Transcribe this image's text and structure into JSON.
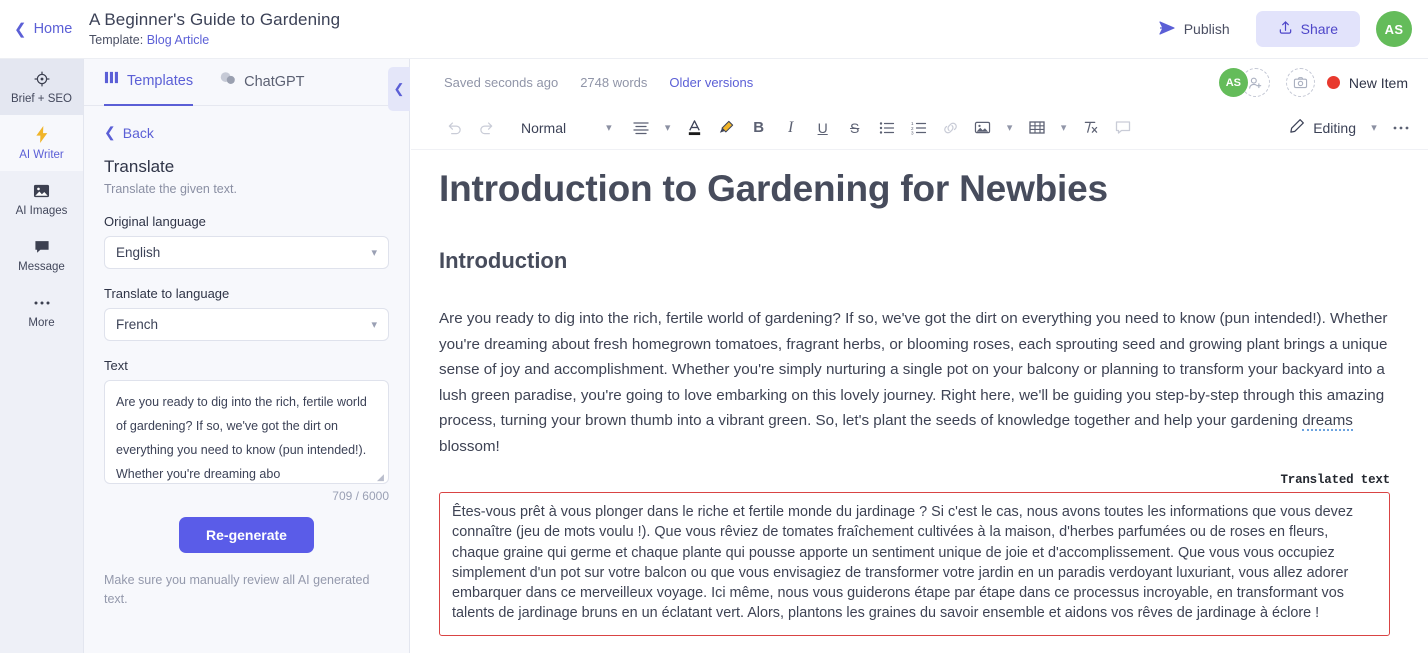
{
  "topbar": {
    "home_label": "Home",
    "back_icon": "chevron-left-icon",
    "doc_title": "A Beginner's Guide to Gardening",
    "template_prefix": "Template:",
    "template_name": "Blog Article",
    "publish_label": "Publish",
    "publish_icon": "send-icon",
    "share_label": "Share",
    "share_icon": "upload-icon",
    "avatar_initials": "AS"
  },
  "rail": {
    "items": [
      {
        "label": "Brief + SEO",
        "icon": "target-icon",
        "state": "hover"
      },
      {
        "label": "AI Writer",
        "icon": "lightning-icon",
        "state": "active"
      },
      {
        "label": "AI Images",
        "icon": "image-icon",
        "state": "default"
      },
      {
        "label": "Message",
        "icon": "message-icon",
        "state": "default"
      },
      {
        "label": "More",
        "icon": "ellipsis-icon",
        "state": "default"
      }
    ]
  },
  "panel": {
    "tabs": [
      {
        "label": "Templates",
        "icon": "templates-icon",
        "active": true
      },
      {
        "label": "ChatGPT",
        "icon": "chat-icon",
        "active": false
      }
    ],
    "collapse_icon": "chevron-left-icon",
    "back_label": "Back",
    "title": "Translate",
    "description": "Translate the given text.",
    "original_language_label": "Original language",
    "original_language_value": "English",
    "target_language_label": "Translate to language",
    "target_language_value": "French",
    "text_label": "Text",
    "text_value": "Are you ready to dig into the rich, fertile world of gardening? If so, we've got the dirt on everything you need to know (pun intended!). Whether you're dreaming abo",
    "char_count": "709 / 6000",
    "regenerate_label": "Re-generate",
    "note": "Make sure you manually review all AI generated text."
  },
  "editor": {
    "status": {
      "saved": "Saved seconds ago",
      "words": "2748 words",
      "older_versions": "Older versions",
      "avatar_initials": "AS",
      "add_person_icon": "add-person-icon",
      "add_asset_icon": "add-image-icon",
      "new_item_label": "New Item"
    },
    "toolbar": {
      "undo_icon": "undo-icon",
      "redo_icon": "redo-icon",
      "style_value": "Normal",
      "style_caret_icon": "chevron-down-icon",
      "align_icon": "align-icon",
      "align_caret_icon": "chevron-down-icon",
      "text_color_icon": "text-color-icon",
      "highlight_icon": "highlighter-icon",
      "bold_icon": "bold-icon",
      "italic_icon": "italic-icon",
      "underline_icon": "underline-icon",
      "strikethrough_icon": "strikethrough-icon",
      "bullet_list_icon": "bullet-list-icon",
      "numbered_list_icon": "numbered-list-icon",
      "link_icon": "link-icon",
      "image_icon": "image-icon",
      "image_caret_icon": "chevron-down-icon",
      "table_icon": "table-icon",
      "table_caret_icon": "chevron-down-icon",
      "clear_format_icon": "clear-format-icon",
      "comment_icon": "comment-icon",
      "editing_label": "Editing",
      "editing_icon": "pencil-icon",
      "editing_caret_icon": "chevron-down-icon",
      "more_icon": "ellipsis-icon"
    },
    "document": {
      "h1": "Introduction to Gardening for Newbies",
      "h2": "Introduction",
      "paragraph_part1": "Are you ready to dig into the rich, fertile world of gardening? If so, we've got the dirt on everything you need to know (pun intended!). Whether you're dreaming about fresh homegrown tomatoes, fragrant herbs, or blooming roses, each sprouting seed and growing plant brings a unique sense of joy and accomplishment. Whether you're simply nurturing a single pot on your balcony or planning to transform your backyard into a lush green paradise, you're going to love embarking on this lovely journey. Right here, we'll be guiding you step-by-step through this amazing process, turning your brown thumb into a vibrant green. So, let's plant the seeds of knowledge together and help your gardening ",
      "paragraph_spellword": "dreams",
      "paragraph_part2": " blossom!",
      "translated_label": "Translated text",
      "translated_text": "Êtes-vous prêt à vous plonger dans le riche et fertile monde du jardinage ? Si c'est le cas, nous avons toutes les informations que vous devez connaître (jeu de mots voulu !). Que vous rêviez de tomates fraîchement cultivées à la maison, d'herbes parfumées ou de roses en fleurs, chaque graine qui germe et chaque plante qui pousse apporte un sentiment unique de joie et d'accomplissement. Que vous vous occupiez simplement d'un pot sur votre balcon ou que vous envisagiez de transformer votre jardin en un paradis verdoyant luxuriant, vous allez adorer embarquer dans ce merveilleux voyage. Ici même, nous vous guiderons étape par étape dans ce processus incroyable, en transformant vos talents de jardinage bruns en un éclatant vert. Alors, plantons les graines du savoir ensemble et aidons vos rêves de jardinage à éclore !"
    }
  },
  "colors": {
    "accent": "#5b5fd6",
    "primary_button": "#5a5ce8",
    "share_bg": "#e2e3fb",
    "avatar_green": "#64bc5a",
    "alert_red": "#d94444",
    "new_item_dot": "#e8392e",
    "panel_bg": "#f7f8fc",
    "rail_bg": "#eef0f7"
  }
}
